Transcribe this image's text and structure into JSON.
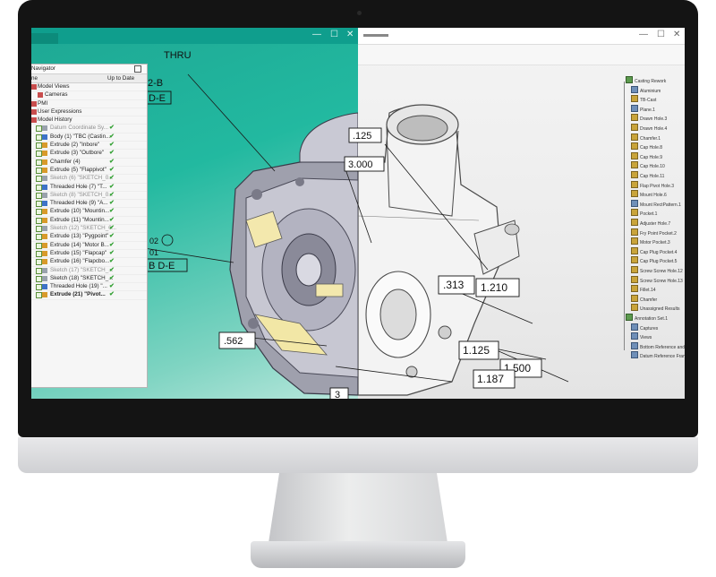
{
  "left_window": {
    "controls": [
      "—",
      "☐",
      "✕"
    ]
  },
  "right_window": {
    "controls": [
      "—",
      "☐",
      "✕"
    ]
  },
  "navigator": {
    "title": "Navigator",
    "col_name": "ne",
    "col_status": "Up to Date",
    "rows": [
      {
        "label": "Model Views",
        "indent": 0,
        "check": false,
        "ok": false,
        "dim": false,
        "bold": false
      },
      {
        "label": "Cameras",
        "indent": 1,
        "check": false,
        "ok": false,
        "dim": false,
        "bold": false
      },
      {
        "label": "PMI",
        "indent": 0,
        "check": false,
        "ok": false,
        "dim": false,
        "bold": false
      },
      {
        "label": "User Expressions",
        "indent": 0,
        "check": false,
        "ok": false,
        "dim": false,
        "bold": false
      },
      {
        "label": "Model History",
        "indent": 0,
        "check": false,
        "ok": false,
        "dim": false,
        "bold": false
      },
      {
        "label": "Datum Coordinate Sy...",
        "indent": 1,
        "check": true,
        "ok": true,
        "dim": true,
        "bold": false
      },
      {
        "label": "Body (1) \"TBC (Castin...",
        "indent": 1,
        "check": true,
        "ok": true,
        "dim": false,
        "bold": false
      },
      {
        "label": "Extrude (2) \"Inbore\"",
        "indent": 1,
        "check": true,
        "ok": true,
        "dim": false,
        "bold": false
      },
      {
        "label": "Extrude (3) \"Outbore\"",
        "indent": 1,
        "check": true,
        "ok": true,
        "dim": false,
        "bold": false
      },
      {
        "label": "Chamfer (4)",
        "indent": 1,
        "check": true,
        "ok": true,
        "dim": false,
        "bold": false
      },
      {
        "label": "Extrude (5) \"Flappivot\"",
        "indent": 1,
        "check": true,
        "ok": true,
        "dim": false,
        "bold": false
      },
      {
        "label": "Sketch (6) \"SKETCH_0...",
        "indent": 1,
        "check": true,
        "ok": true,
        "dim": true,
        "bold": false
      },
      {
        "label": "Threaded Hole (7) \"T...",
        "indent": 1,
        "check": true,
        "ok": true,
        "dim": false,
        "bold": false
      },
      {
        "label": "Sketch (8) \"SKETCH_0...",
        "indent": 1,
        "check": true,
        "ok": true,
        "dim": true,
        "bold": false
      },
      {
        "label": "Threaded Hole (9) \"A...",
        "indent": 1,
        "check": true,
        "ok": true,
        "dim": false,
        "bold": false
      },
      {
        "label": "Extrude (10) \"Mountin...",
        "indent": 1,
        "check": true,
        "ok": true,
        "dim": false,
        "bold": false
      },
      {
        "label": "Extrude (11) \"Mountin...",
        "indent": 1,
        "check": true,
        "ok": true,
        "dim": false,
        "bold": false
      },
      {
        "label": "Sketch (12) \"SKETCH_0...",
        "indent": 1,
        "check": true,
        "ok": true,
        "dim": true,
        "bold": false
      },
      {
        "label": "Extrude (13) \"Pygpoint\"",
        "indent": 1,
        "check": true,
        "ok": true,
        "dim": false,
        "bold": false
      },
      {
        "label": "Extrude (14) \"Motor B...",
        "indent": 1,
        "check": true,
        "ok": true,
        "dim": false,
        "bold": false
      },
      {
        "label": "Extrude (15) \"Flapcap\"",
        "indent": 1,
        "check": true,
        "ok": true,
        "dim": false,
        "bold": false
      },
      {
        "label": "Extrude (16) \"Flapcbo...",
        "indent": 1,
        "check": true,
        "ok": true,
        "dim": false,
        "bold": false
      },
      {
        "label": "Sketch (17) \"SKETCH_...",
        "indent": 1,
        "check": true,
        "ok": true,
        "dim": true,
        "bold": false
      },
      {
        "label": "Sketch (18) \"SKETCH_...",
        "indent": 1,
        "check": true,
        "ok": true,
        "dim": false,
        "bold": false
      },
      {
        "label": "Threaded Hole (19) \"...",
        "indent": 1,
        "check": true,
        "ok": true,
        "dim": false,
        "bold": false
      },
      {
        "label": "Extrude (21) \"Pivot...",
        "indent": 1,
        "check": true,
        "ok": true,
        "dim": false,
        "bold": true
      }
    ]
  },
  "dimensions": {
    "thru": "THRU",
    "b2": "2-B",
    "de_top": "D-E",
    "d125": ".125",
    "d3000": "3.000",
    "d02": "02",
    "d01": "01",
    "bde": "B D-E",
    "d562": ".562",
    "d3": "3",
    "d313": ".313",
    "d1210": "1.210",
    "d1125": "1.125",
    "d1500": "1.500",
    "d1187": "1.187"
  },
  "tree": {
    "items": [
      {
        "label": "Casting Rework",
        "indent": 0,
        "icon": "g"
      },
      {
        "label": "Aluminium",
        "indent": 1,
        "icon": "b"
      },
      {
        "label": "TB-Cast",
        "indent": 1,
        "icon": "y"
      },
      {
        "label": "Plane.1",
        "indent": 1,
        "icon": "b"
      },
      {
        "label": "Drawn Hole.3",
        "indent": 1,
        "icon": "y"
      },
      {
        "label": "Drawn Hole.4",
        "indent": 1,
        "icon": "y"
      },
      {
        "label": "Chamfer.1",
        "indent": 1,
        "icon": "y"
      },
      {
        "label": "Cap Hole.8",
        "indent": 1,
        "icon": "y"
      },
      {
        "label": "Cap Hole.9",
        "indent": 1,
        "icon": "y"
      },
      {
        "label": "Cap Hole.10",
        "indent": 1,
        "icon": "y"
      },
      {
        "label": "Cap Hole.11",
        "indent": 1,
        "icon": "y"
      },
      {
        "label": "Flap Pivot Hole.3",
        "indent": 1,
        "icon": "y"
      },
      {
        "label": "Mount Hole.6",
        "indent": 1,
        "icon": "y"
      },
      {
        "label": "Mount RectPattern.1",
        "indent": 1,
        "icon": "b"
      },
      {
        "label": "Pocket.1",
        "indent": 1,
        "icon": "y"
      },
      {
        "label": "Adjuster Hole.7",
        "indent": 1,
        "icon": "y"
      },
      {
        "label": "Fry Point Pocket.2",
        "indent": 1,
        "icon": "y"
      },
      {
        "label": "Motor Pocket.3",
        "indent": 1,
        "icon": "y"
      },
      {
        "label": "Cap Plug Pocket.4",
        "indent": 1,
        "icon": "y"
      },
      {
        "label": "Cap Plug Pocket.5",
        "indent": 1,
        "icon": "y"
      },
      {
        "label": "Screw Screw Hole.12",
        "indent": 1,
        "icon": "y"
      },
      {
        "label": "Screw Screw Hole.13",
        "indent": 1,
        "icon": "y"
      },
      {
        "label": "Fillet.14",
        "indent": 1,
        "icon": "y"
      },
      {
        "label": "Chamfer",
        "indent": 1,
        "icon": "y"
      },
      {
        "label": "Unassigned Results",
        "indent": 1,
        "icon": "y"
      },
      {
        "label": "Annotation Set.1",
        "indent": 0,
        "icon": "g"
      },
      {
        "label": "Captures",
        "indent": 1,
        "icon": "b"
      },
      {
        "label": "Views",
        "indent": 1,
        "icon": "b"
      },
      {
        "label": "Bottom Reference and Hole Pos",
        "indent": 1,
        "icon": "b"
      },
      {
        "label": "Datum Reference Frames",
        "indent": 1,
        "icon": "b"
      }
    ]
  }
}
